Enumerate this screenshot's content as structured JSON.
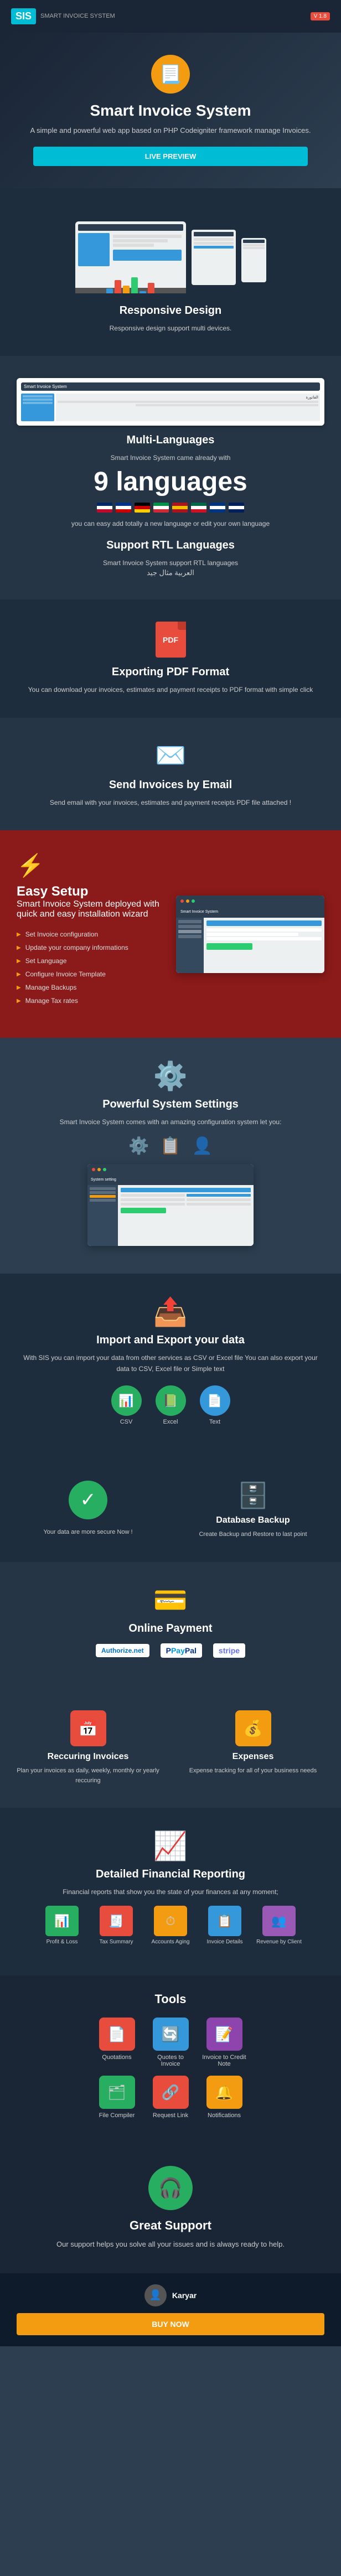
{
  "header": {
    "logo": "SIS",
    "logo_sub": "SMART INVOICE SYSTEM",
    "version": "V 1.8"
  },
  "hero": {
    "title": "Smart Invoice System",
    "subtitle": "A simple and powerful web app based on PHP Codeigniter framework manage Invoices.",
    "preview_btn": "LIVE PREVIEW"
  },
  "features": {
    "responsive": {
      "title": "Responsive Design",
      "desc": "Responsive design support multi devices."
    },
    "multilang": {
      "title": "Multi-Languages",
      "intro": "Smart Invoice System came already with",
      "count": "9 languages",
      "desc": "you can easy add totally a new language or edit your own language"
    },
    "rtl": {
      "title": "Support RTL Languages",
      "desc": "Smart Invoice System support RTL languages",
      "rtl_sample": "العربية مثال جيد"
    },
    "pdf": {
      "title": "Exporting PDF Format",
      "desc": "You can download your invoices, estimates and payment receipts to PDF format with simple click"
    },
    "email": {
      "title": "Send Invoices by Email",
      "desc": "Send email with your invoices, estimates and payment receipts PDF file attached !"
    },
    "setup": {
      "title": "Easy Setup",
      "desc": "Smart Invoice System deployed with quick and easy installation wizard",
      "list": [
        "Set Invoice configuration",
        "Update your company informations",
        "Set Language",
        "Configure Invoice Template",
        "Manage Backups",
        "Manage Tax rates"
      ]
    },
    "settings": {
      "title": "Powerful System Settings",
      "desc": "Smart Invoice System comes with an amazing configuration system let you:"
    },
    "import": {
      "title": "Import and Export your data",
      "desc": "With SIS you can import your data from other services as CSV or Excel file\nYou can also export your data to CSV, Excel file or Simple text"
    },
    "backup": {
      "title": "Database Backup",
      "desc": "Create Backup and Restore to last point"
    },
    "secure": {
      "title": "Your data are more secure Now !"
    },
    "payment": {
      "title": "Online Payment"
    },
    "recurring": {
      "title": "Reccuring Invoices",
      "desc": "Plan your invoices as daily, weekly, monthly or yearly reccuring"
    },
    "expenses": {
      "title": "Expenses",
      "desc": "Expense tracking for all of your business needs"
    },
    "reporting": {
      "title": "Detailed Financial Reporting",
      "desc": "Financial reports that show you the state of your finances at any moment;"
    }
  },
  "report_items": [
    {
      "label": "Profit & Loss",
      "color": "#27ae60",
      "icon": "📊"
    },
    {
      "label": "Tax Summary",
      "color": "#e74c3c",
      "icon": "🧾"
    },
    {
      "label": "Accounts Aging",
      "color": "#f39c12",
      "icon": "⏱"
    },
    {
      "label": "Invoice Details",
      "color": "#3498db",
      "icon": "📋"
    },
    {
      "label": "Revenue by Client",
      "color": "#9b59b6",
      "icon": "👥"
    }
  ],
  "tools": {
    "title": "Tools",
    "row1": [
      {
        "label": "Quotations",
        "color": "#e74c3c",
        "icon": "📄"
      },
      {
        "label": "Quotes to Invoice",
        "color": "#3498db",
        "icon": "🔄"
      },
      {
        "label": "Invoice to Credit Note",
        "color": "#8e44ad",
        "icon": "📝"
      }
    ],
    "row2": [
      {
        "label": "File Compiler",
        "color": "#27ae60",
        "icon": "🗂"
      },
      {
        "label": "Request Link",
        "color": "#e74c3c",
        "icon": "🔗"
      },
      {
        "label": "Notifications",
        "color": "#f39c12",
        "icon": "🔔"
      }
    ]
  },
  "support": {
    "title": "Great Support",
    "desc": "Our support helps you solve all your issues and is always ready to help."
  },
  "footer": {
    "author": "Karyar",
    "buy_label": "BUY NOW"
  },
  "payment_providers": [
    "Authorize.net",
    "PayPal",
    "stripe"
  ]
}
